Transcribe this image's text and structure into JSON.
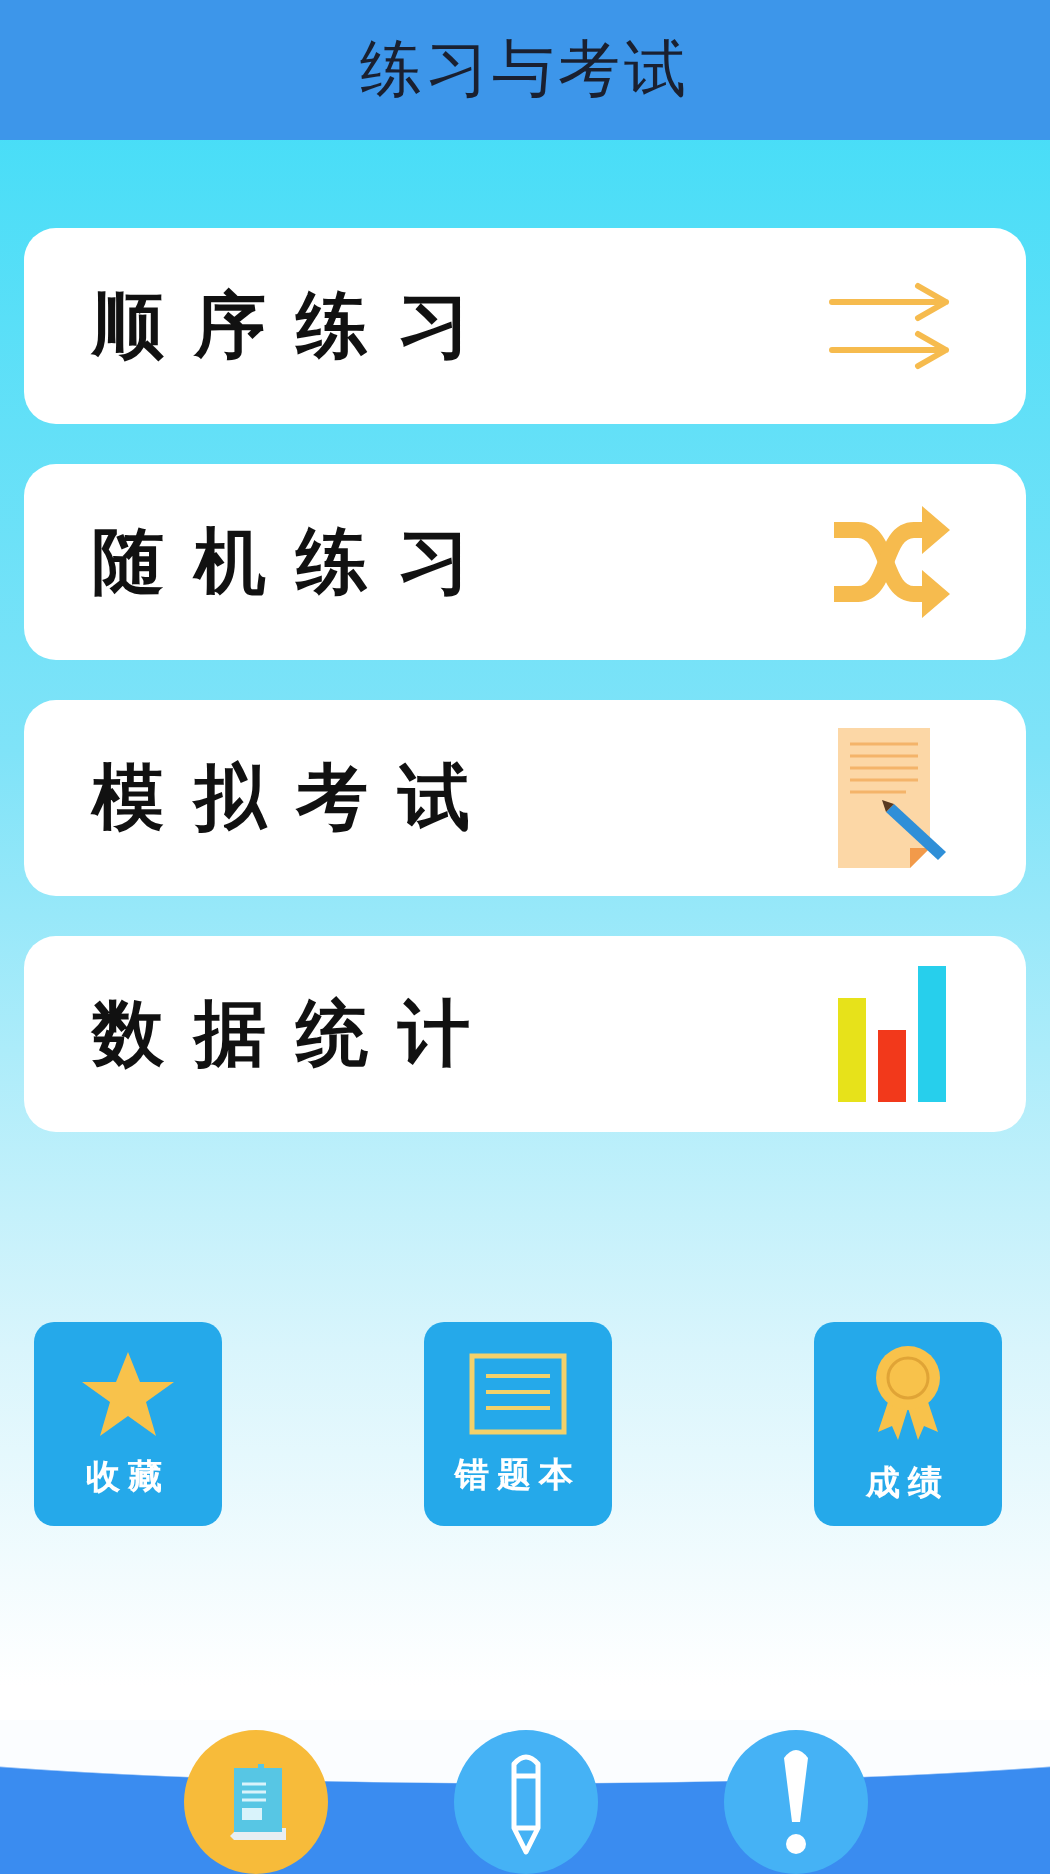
{
  "header": {
    "title": "练习与考试"
  },
  "menu": [
    {
      "label": "顺序练习",
      "kind": "sequential"
    },
    {
      "label": "随机练习",
      "kind": "shuffle"
    },
    {
      "label": "模拟考试",
      "kind": "exam"
    },
    {
      "label": "数据统计",
      "kind": "stats"
    }
  ],
  "tiles": [
    {
      "label": "收藏",
      "kind": "star"
    },
    {
      "label": "错题本",
      "kind": "notebook"
    },
    {
      "label": "成绩",
      "kind": "award"
    }
  ],
  "bottom_nav": [
    {
      "kind": "book",
      "selected": true
    },
    {
      "kind": "pencil",
      "selected": false
    },
    {
      "kind": "alert",
      "selected": false
    }
  ]
}
